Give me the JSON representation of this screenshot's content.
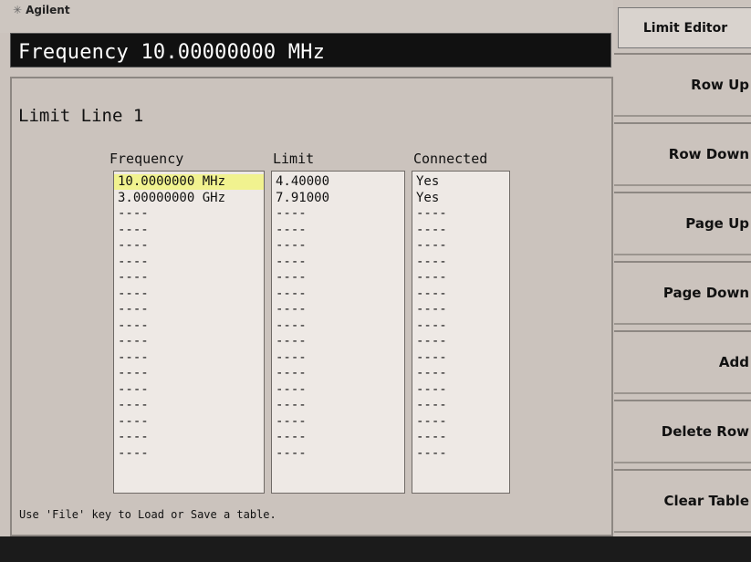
{
  "header": {
    "brand": "Agilent",
    "frequency": "Frequency 10.00000000 MHz"
  },
  "panel": {
    "title": "Limit Line 1",
    "columns": [
      "Frequency",
      "Limit",
      "Connected"
    ],
    "rows": [
      [
        "10.0000000 MHz",
        "4.40000",
        "Yes"
      ],
      [
        "3.00000000 GHz",
        "7.91000",
        "Yes"
      ],
      [
        "----",
        "----",
        "----"
      ],
      [
        "----",
        "----",
        "----"
      ],
      [
        "----",
        "----",
        "----"
      ],
      [
        "----",
        "----",
        "----"
      ],
      [
        "----",
        "----",
        "----"
      ],
      [
        "----",
        "----",
        "----"
      ],
      [
        "----",
        "----",
        "----"
      ],
      [
        "----",
        "----",
        "----"
      ],
      [
        "----",
        "----",
        "----"
      ],
      [
        "----",
        "----",
        "----"
      ],
      [
        "----",
        "----",
        "----"
      ],
      [
        "----",
        "----",
        "----"
      ],
      [
        "----",
        "----",
        "----"
      ],
      [
        "----",
        "----",
        "----"
      ],
      [
        "----",
        "----",
        "----"
      ],
      [
        "----",
        "----",
        "----"
      ]
    ],
    "footer": "Use 'File' key to Load or Save a table."
  },
  "softkeys": {
    "menu_title": "Limit Editor",
    "keys": [
      "Row Up",
      "Row Down",
      "Page Up",
      "Page Down",
      "Add",
      "Delete Row",
      "Clear Table"
    ]
  }
}
